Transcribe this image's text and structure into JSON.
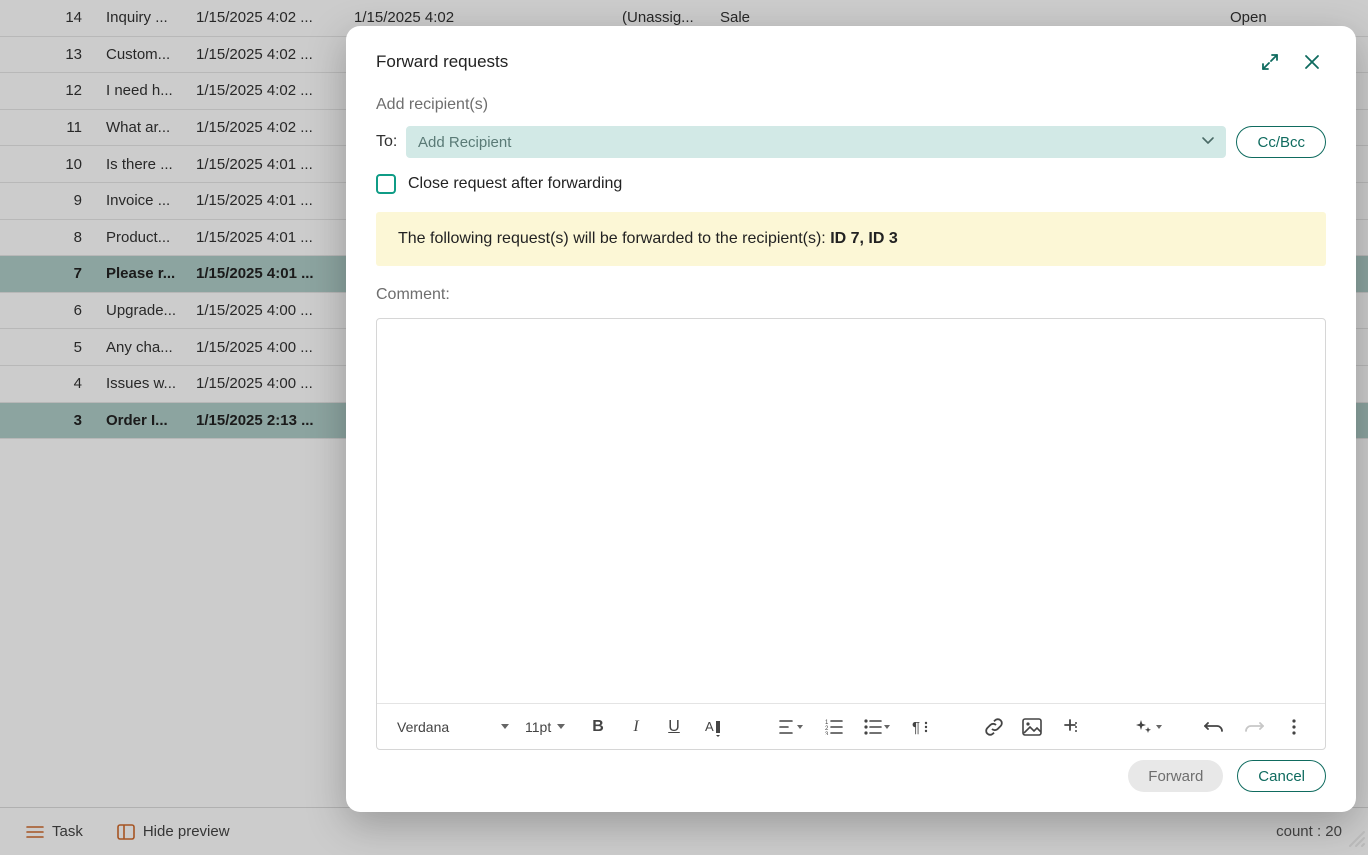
{
  "table": {
    "rows": [
      {
        "id": "14",
        "subject": "Inquiry ...",
        "date": "1/15/2025 4:02 ...",
        "date2": "1/15/2025 4:02",
        "assignee": "(Unassig...",
        "category": "Sale",
        "status": "Open",
        "selected": false
      },
      {
        "id": "13",
        "subject": "Custom...",
        "date": "1/15/2025 4:02 ...",
        "selected": false
      },
      {
        "id": "12",
        "subject": "I need h...",
        "date": "1/15/2025 4:02 ...",
        "selected": false
      },
      {
        "id": "11",
        "subject": "What ar...",
        "date": "1/15/2025 4:02 ...",
        "selected": false
      },
      {
        "id": "10",
        "subject": "Is there ...",
        "date": "1/15/2025 4:01 ...",
        "selected": false
      },
      {
        "id": "9",
        "subject": "Invoice ...",
        "date": "1/15/2025 4:01 ...",
        "selected": false
      },
      {
        "id": "8",
        "subject": "Product...",
        "date": "1/15/2025 4:01 ...",
        "selected": false
      },
      {
        "id": "7",
        "subject": "Please r...",
        "date": "1/15/2025 4:01 ...",
        "selected": true
      },
      {
        "id": "6",
        "subject": "Upgrade...",
        "date": "1/15/2025 4:00 ...",
        "selected": false
      },
      {
        "id": "5",
        "subject": "Any cha...",
        "date": "1/15/2025 4:00 ...",
        "selected": false
      },
      {
        "id": "4",
        "subject": "Issues w...",
        "date": "1/15/2025 4:00 ...",
        "selected": false
      },
      {
        "id": "3",
        "subject": "Order I...",
        "date": "1/15/2025 2:13 ...",
        "selected": true
      }
    ]
  },
  "bottom_bar": {
    "task_label": "Task",
    "hide_preview_label": "Hide preview",
    "count_label": "count : 20"
  },
  "modal": {
    "title": "Forward requests",
    "add_recipients_label": "Add recipient(s)",
    "to_label": "To:",
    "recipient_placeholder": "Add Recipient",
    "ccbcc_label": "Cc/Bcc",
    "close_after_label": "Close request after forwarding",
    "info_prefix": "The following request(s) will be forwarded to the recipient(s): ",
    "info_ids": "ID 7, ID 3",
    "comment_label": "Comment:",
    "editor": {
      "font_family": "Verdana",
      "font_size": "11pt"
    },
    "buttons": {
      "forward": "Forward",
      "cancel": "Cancel"
    }
  }
}
